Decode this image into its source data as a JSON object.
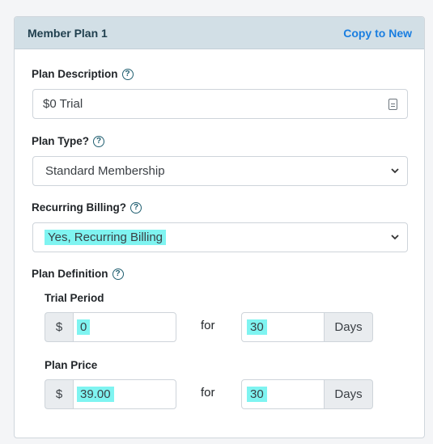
{
  "header": {
    "title": "Member Plan 1",
    "copy_link": "Copy to New"
  },
  "plan_description": {
    "label": "Plan Description",
    "value": "$0 Trial"
  },
  "plan_type": {
    "label": "Plan Type?",
    "selected": "Standard Membership"
  },
  "recurring_billing": {
    "label": "Recurring Billing?",
    "selected": "Yes, Recurring Billing"
  },
  "plan_definition": {
    "label": "Plan Definition",
    "help": "?",
    "trial_period": {
      "label": "Trial Period",
      "currency": "$",
      "amount": "0",
      "for": "for",
      "duration": "30",
      "unit": "Days"
    },
    "plan_price": {
      "label": "Plan Price",
      "currency": "$",
      "amount": "39.00",
      "for": "for",
      "duration": "30",
      "unit": "Days"
    }
  },
  "help_glyph": "?",
  "colors": {
    "header_bg": "#d2dfe6",
    "link": "#1a7ee0",
    "highlight": "#7ff4f1"
  }
}
